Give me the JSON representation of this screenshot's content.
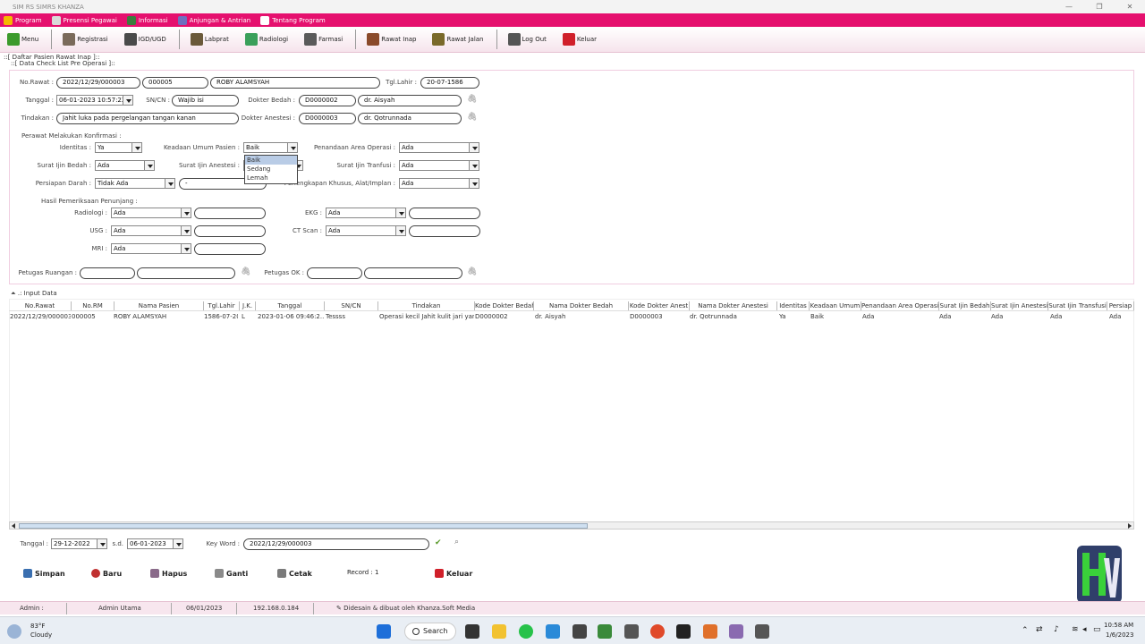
{
  "window": {
    "title": "SIM RS SIMRS KHANZA",
    "controls": [
      "—",
      "❐",
      "✕"
    ]
  },
  "menubar": [
    {
      "label": "Program",
      "color": "#f5b800"
    },
    {
      "label": "Presensi Pegawai",
      "color": "#d9d9d9"
    },
    {
      "label": "Informasi",
      "color": "#3b7c3e"
    },
    {
      "label": "Anjungan & Antrian",
      "color": "#6f6fbf"
    },
    {
      "label": "Tentang Program",
      "color": "#ffffff"
    }
  ],
  "toolbar": [
    {
      "label": "Menu",
      "color": "#3c9a2c"
    },
    {
      "label": "Registrasi",
      "color": "#7a6a5a"
    },
    {
      "label": "IGD/UGD",
      "color": "#4a4a4a"
    },
    {
      "label": "Labprat",
      "color": "#6b5a3a"
    },
    {
      "label": "Radiologi",
      "color": "#3aa05a"
    },
    {
      "label": "Farmasi",
      "color": "#5a5a5a"
    },
    {
      "label": "Rawat Inap",
      "color": "#8a4a2a"
    },
    {
      "label": "Rawat Jalan",
      "color": "#7a6a2a"
    },
    {
      "label": "Log Out",
      "color": "#555555"
    },
    {
      "label": "Keluar",
      "color": "#d0202a"
    }
  ],
  "sections": {
    "outer": "::[ Daftar Pasien Rawat Inap ]::",
    "inner": "::[ Data Check List Pre Operasi ]::",
    "input_data": ".: Input Data"
  },
  "form": {
    "no_rawat_label": "No.Rawat :",
    "no_rawat": "2022/12/29/000003",
    "no_rm": "000005",
    "nama": "ROBY ALAMSYAH",
    "tgl_lahir_label": "Tgl.Lahir :",
    "tgl_lahir": "20-07-1586",
    "tanggal_label": "Tanggal :",
    "tanggal": "06-01-2023 10:57:22",
    "sncn_label": "SN/CN :",
    "sncn": "Wajib isi",
    "dokter_bedah_label": "Dokter Bedah :",
    "dokter_bedah_kode": "D0000002",
    "dokter_bedah_nama": "dr. Aisyah",
    "tindakan_label": "Tindakan :",
    "tindakan": "Jahit luka pada pergelangan tangan kanan",
    "dokter_anestesi_label": "Dokter Anestesi :",
    "dokter_anestesi_kode": "D0000003",
    "dokter_anestesi_nama": "dr. Qotrunnada",
    "perawat_label": "Perawat Melakukan Konfirmasi :",
    "identitas_label": "Identitas :",
    "identitas": "Ya",
    "keadaan_label": "Keadaan Umum Pasien :",
    "keadaan": "Baik",
    "penandaan_label": "Penandaan Area Operasi :",
    "penandaan": "Ada",
    "surat_bedah_label": "Surat Ijin Bedah :",
    "surat_bedah": "Ada",
    "surat_anestesi_label": "Surat Ijin Anestesi :",
    "surat_transfusi_label": "Surat Ijin Tranfusi :",
    "surat_transfusi": "Ada",
    "persiapan_darah_label": "Persiapan Darah :",
    "persiapan_darah": "Tidak Ada",
    "persiapan_darah_ket": "-",
    "perlengkapan_label": "Perlengkapan Khusus, Alat/Implan :",
    "perlengkapan": "Ada",
    "hasil_label": "Hasil Pemeriksaan Penunjang :",
    "radiologi_label": "Radiologi :",
    "radiologi": "Ada",
    "ekg_label": "EKG :",
    "ekg": "Ada",
    "usg_label": "USG :",
    "usg": "Ada",
    "ctscan_label": "CT Scan :",
    "ctscan": "Ada",
    "mri_label": "MRI :",
    "mri": "Ada",
    "petugas_ruangan_label": "Petugas Ruangan :",
    "petugas_ok_label": "Petugas OK :"
  },
  "dropdown_options": [
    "Baik",
    "Sedang",
    "Lemah"
  ],
  "table": {
    "headers": [
      "No.Rawat",
      "No.RM",
      "Nama Pasien",
      "Tgl.Lahir",
      "J.K.",
      "Tanggal",
      "SN/CN",
      "Tindakan",
      "Kode Dokter Bedah",
      "Nama Dokter Bedah",
      "Kode Dokter Anest",
      "Nama Dokter Anestesi",
      "Identitas",
      "Keadaan Umum",
      "Penandaan Area Operasi",
      "Surat Ijin Bedah",
      "Surat Ijin Anestesi",
      "Surat Ijin Transfusi",
      "Persiap"
    ],
    "rows": [
      [
        "2022/12/29/000003",
        "000005",
        "ROBY ALAMSYAH",
        "1586-07-20",
        "L",
        "2023-01-06 09:46:2...",
        "Tessss",
        "Operasi kecil Jahit kulit jari yan...",
        "D0000002",
        "dr. Aisyah",
        "D0000003",
        "dr. Qotrunnada",
        "Ya",
        "Baik",
        "Ada",
        "Ada",
        "Ada",
        "Ada",
        "Ada"
      ]
    ]
  },
  "filter": {
    "tanggal_label": "Tanggal :",
    "from": "29-12-2022",
    "sd_label": "s.d.",
    "to": "06-01-2023",
    "keyword_label": "Key Word :",
    "keyword": "2022/12/29/000003"
  },
  "buttons": {
    "simpan": "Simpan",
    "baru": "Baru",
    "hapus": "Hapus",
    "ganti": "Ganti",
    "cetak": "Cetak",
    "record": "Record :  1",
    "keluar": "Keluar"
  },
  "status": {
    "admin_label": "Admin :",
    "user": "Admin Utama",
    "date": "06/01/2023",
    "ip": "192.168.0.184",
    "credit": "Didesain & dibuat oleh Khanza.Soft Media"
  },
  "taskbar": {
    "weather_temp": "83°F",
    "weather_desc": "Cloudy",
    "search": "Search",
    "time": "10:58 AM",
    "date": "1/6/2023"
  }
}
